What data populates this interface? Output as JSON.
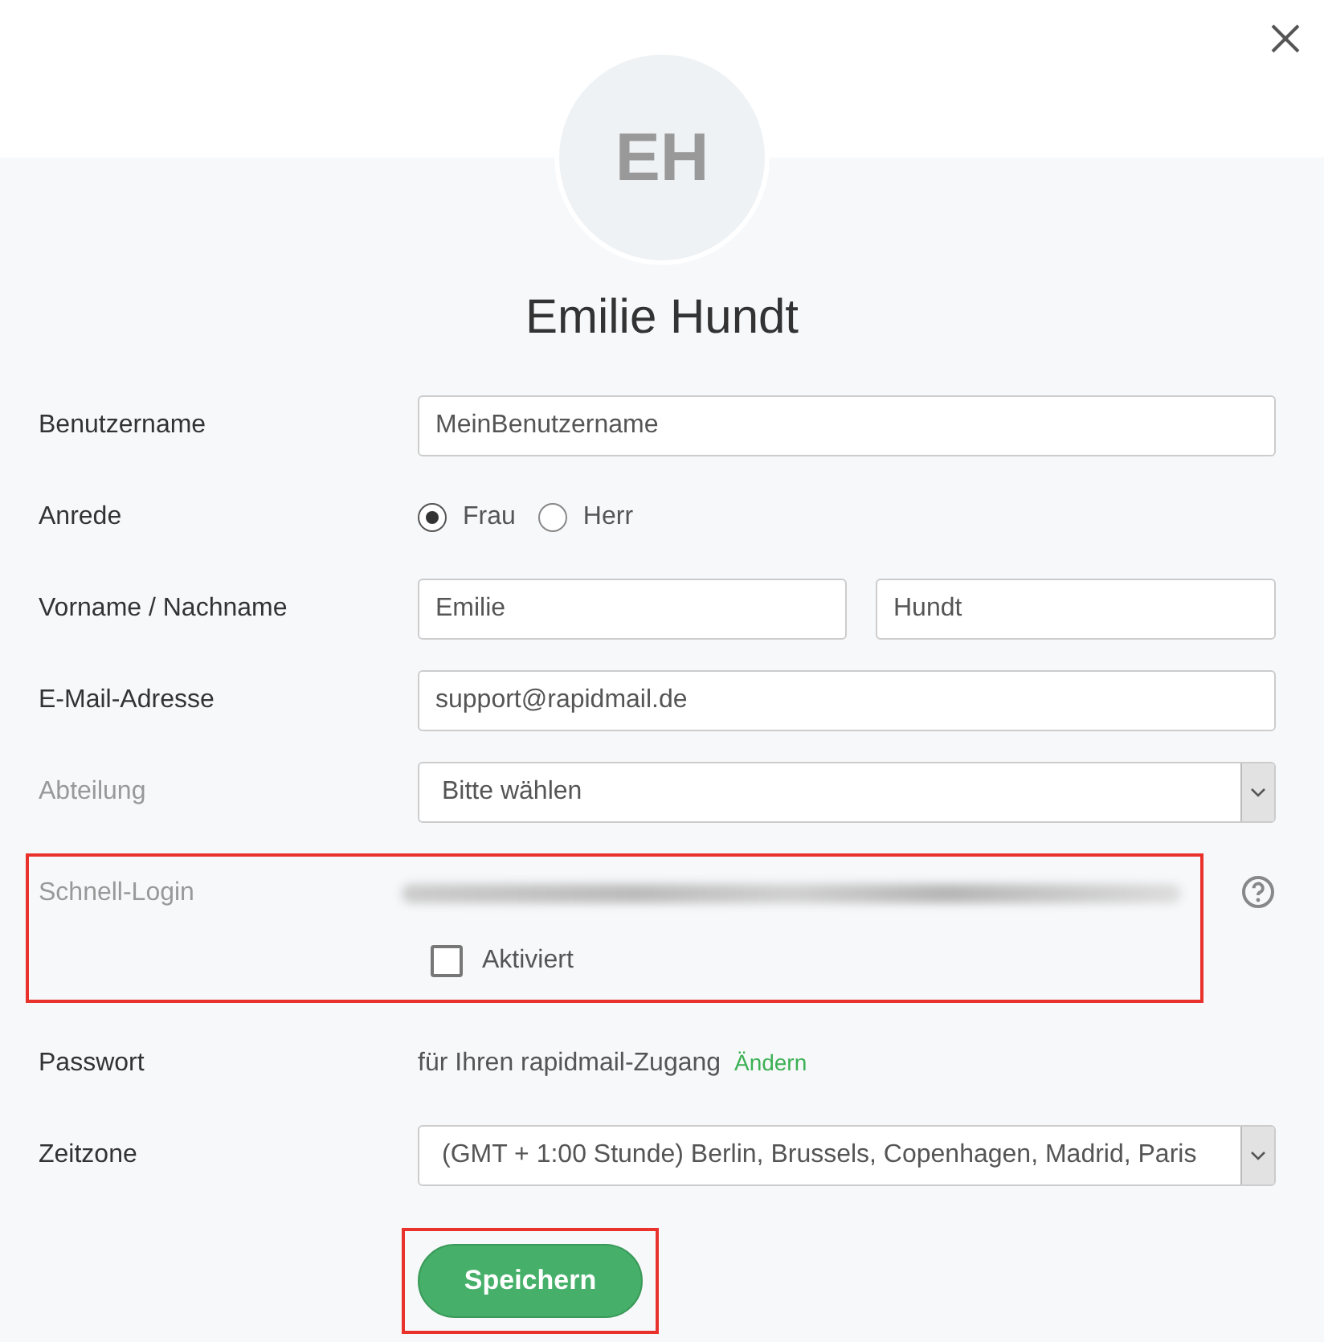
{
  "avatar": {
    "initials": "EH"
  },
  "name": "Emilie Hundt",
  "fields": [
    {
      "kind": "text",
      "label": "Benutzername",
      "disabled": false,
      "value": "MeinBenutzername"
    },
    {
      "kind": "radio",
      "label": "Anrede",
      "disabled": false,
      "options": [
        {
          "label": "Frau",
          "selected": true
        },
        {
          "label": "Herr",
          "selected": false
        }
      ]
    },
    {
      "kind": "name",
      "label": "Vorname / Nachname",
      "disabled": false,
      "values": [
        "Emilie",
        "Hundt"
      ]
    },
    {
      "kind": "text",
      "label": "E-Mail-Adresse",
      "disabled": false,
      "value": "support@rapidmail.de"
    },
    {
      "kind": "select",
      "label": "Abteilung",
      "disabled": true,
      "value": "Bitte wählen"
    },
    {
      "kind": "quicklogin",
      "label": "Schnell-Login",
      "disabled": true,
      "highlighted": true,
      "checkbox": {
        "label": "Aktiviert",
        "checked": false
      }
    },
    {
      "kind": "password",
      "label": "Passwort",
      "disabled": false,
      "text": "für Ihren rapidmail-Zugang",
      "link": "Ändern"
    },
    {
      "kind": "select",
      "label": "Zeitzone",
      "disabled": false,
      "value": "(GMT + 1:00 Stunde) Berlin, Brussels, Copenhagen, Madrid, Paris"
    }
  ],
  "save_button": {
    "label": "Speichern",
    "highlighted": true
  }
}
